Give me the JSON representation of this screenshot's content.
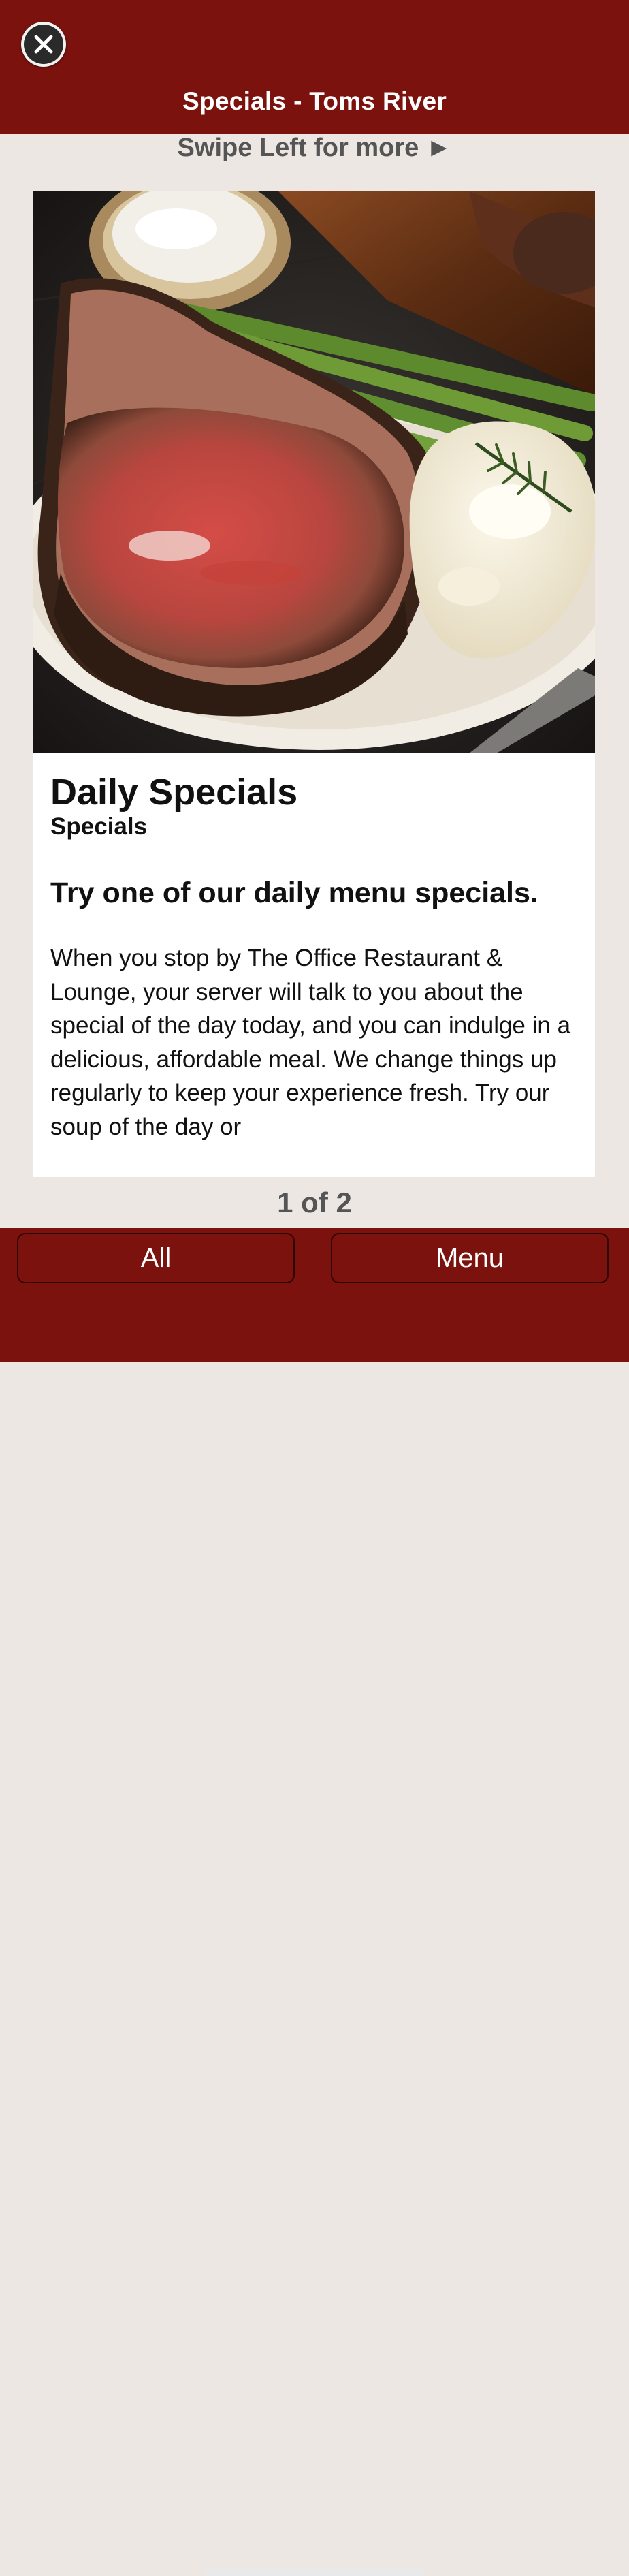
{
  "header": {
    "title": "Specials - Toms River",
    "close_icon": "close-icon"
  },
  "swipe_hint": "Swipe Left for more ►",
  "card": {
    "image": "prime-rib-plate-photo",
    "title": "Daily Specials",
    "subtitle": "Specials",
    "heading": "Try one of our daily menu specials.",
    "body": "When you stop by The Office Restaurant & Lounge, your server will talk to you about the special of the day today, and you can indulge in a delicious, affordable meal. We change things up regularly to keep your experience fresh. Try our soup of the day or"
  },
  "pager": "1 of 2",
  "footer": {
    "all_label": "All",
    "menu_label": "Menu"
  },
  "colors": {
    "brand": "#7b120d",
    "background": "#ede7e3"
  }
}
